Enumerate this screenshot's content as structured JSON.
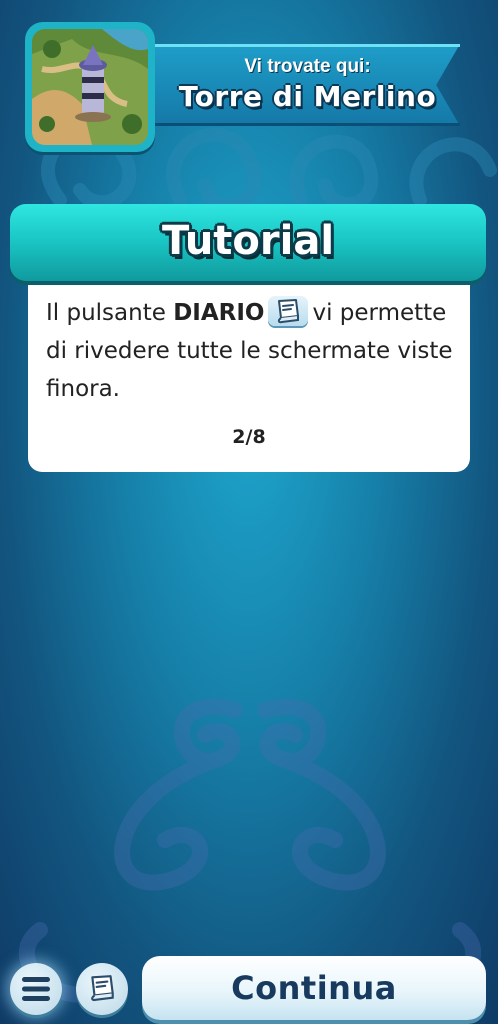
{
  "location": {
    "subtitle": "Vi trovate qui:",
    "name": "Torre di Merlino",
    "thumbnail_icon": "tower-map-thumbnail"
  },
  "tutorial": {
    "title": "Tutorial",
    "text_before": "Il pulsante ",
    "text_bold": "DIARIO",
    "text_after": "vi permette di rivedere tutte le schermate viste finora.",
    "inline_icon": "diary-icon",
    "page": "2/8"
  },
  "bottom_bar": {
    "menu_icon": "menu-icon",
    "diary_icon": "diary-icon",
    "continue_label": "Continua"
  },
  "colors": {
    "background": "#167fa8",
    "tutorial_header": "#1bc8c6",
    "text_dark": "#173a5e"
  }
}
